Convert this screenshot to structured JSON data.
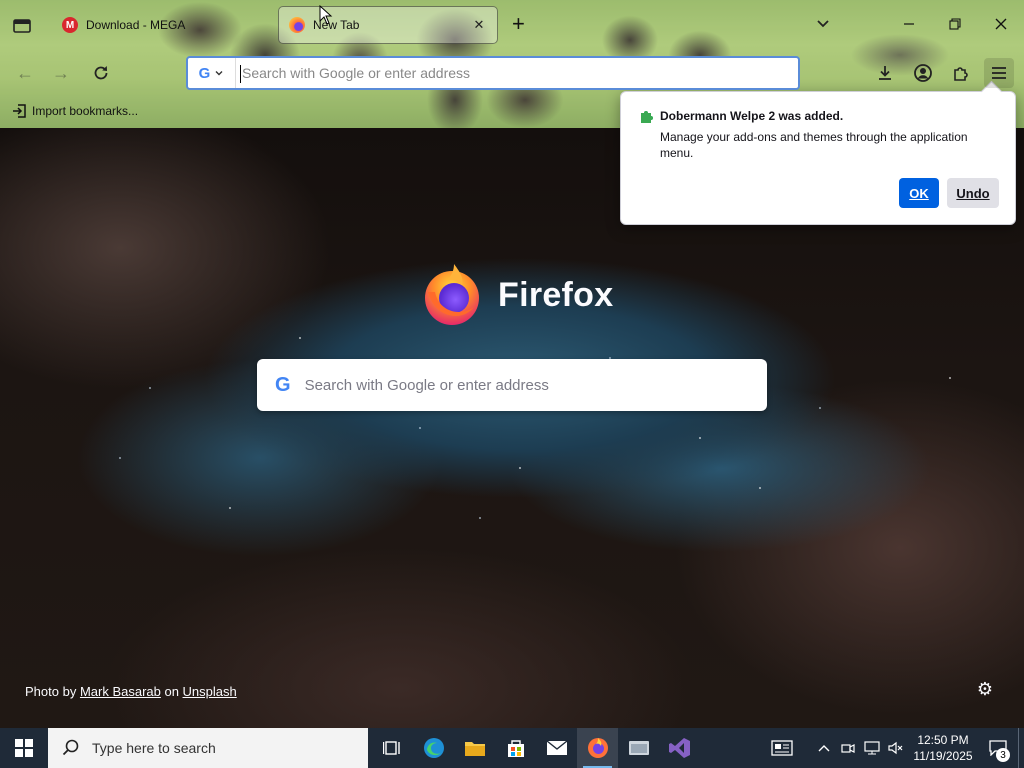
{
  "tabs": [
    {
      "title": "Download - MEGA",
      "favicon": "mega-icon"
    },
    {
      "title": "New Tab",
      "favicon": "firefox-icon"
    }
  ],
  "urlbar": {
    "placeholder": "Search with Google or enter address",
    "engine": "G"
  },
  "bookmarks": {
    "import_label": "Import bookmarks..."
  },
  "newtab": {
    "brand": "Firefox",
    "search_placeholder": "Search with Google or enter address",
    "google_letter": "G",
    "photo_credit": {
      "prefix": "Photo by ",
      "author": "Mark Basarab",
      "on": " on ",
      "site": "Unsplash"
    }
  },
  "notification": {
    "title": "Dobermann Welpe 2 was added.",
    "body": "Manage your add-ons and themes through the application menu.",
    "ok_label": "OK",
    "undo_label": "Undo"
  },
  "taskbar": {
    "search_placeholder": "Type here to search",
    "time": "12:50 PM",
    "date": "11/19/2025",
    "notification_count": "3"
  },
  "colors": {
    "accent": "#0061e0",
    "taskbar": "#1f2a38",
    "urlbar_focus": "#5a8cd8"
  }
}
